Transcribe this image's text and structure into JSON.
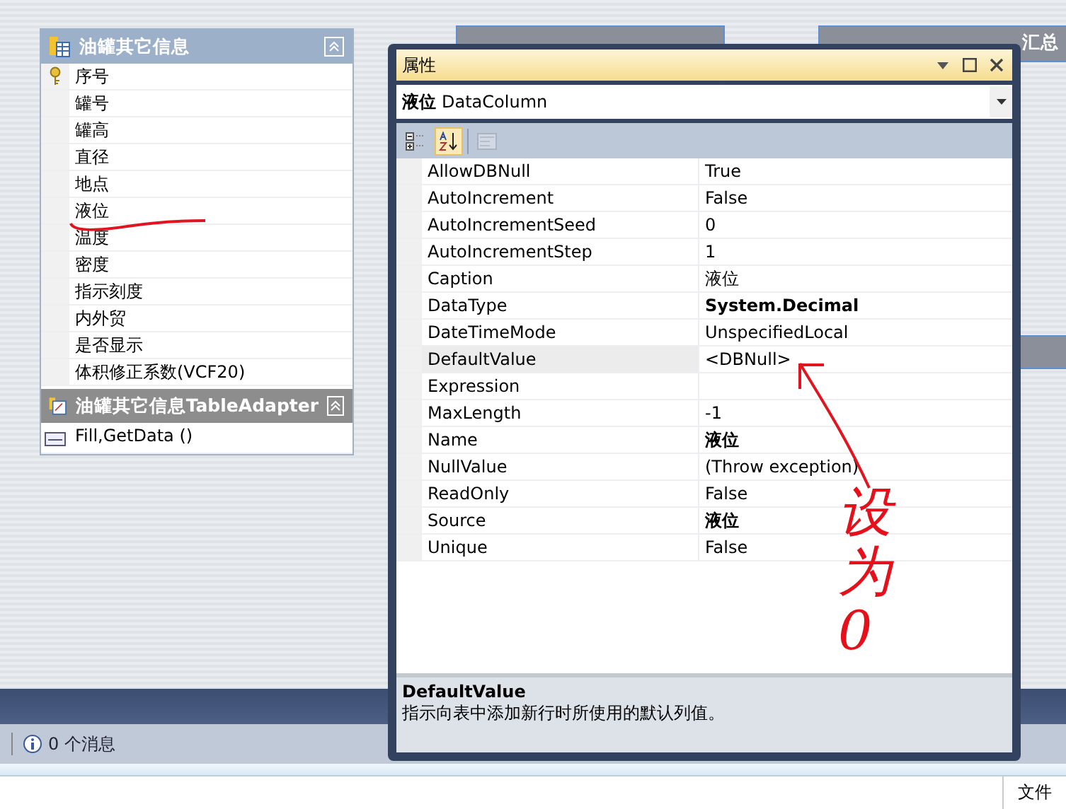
{
  "designer": {
    "tables": [
      {
        "title": "油罐其它信息",
        "columns": [
          {
            "name": "序号",
            "key": true
          },
          {
            "name": "罐号",
            "key": false
          },
          {
            "name": "罐高",
            "key": false
          },
          {
            "name": "直径",
            "key": false
          },
          {
            "name": "地点",
            "key": false
          },
          {
            "name": "液位",
            "key": false
          },
          {
            "name": "温度",
            "key": false
          },
          {
            "name": "密度",
            "key": false
          },
          {
            "name": "指示刻度",
            "key": false
          },
          {
            "name": "内外贸",
            "key": false
          },
          {
            "name": "是否显示",
            "key": false
          },
          {
            "name": "体积修正系数(VCF20)",
            "key": false
          }
        ],
        "adapter": {
          "title": "油罐其它信息TableAdapter",
          "methods": [
            "Fill,GetData ()"
          ]
        }
      }
    ],
    "obscured_table_title": "汇总"
  },
  "properties": {
    "title": "属性",
    "object": {
      "name": "液位",
      "type": "DataColumn"
    },
    "toolbar": [
      {
        "kind": "categorized",
        "selected": false,
        "disabled": false
      },
      {
        "kind": "alphabetical",
        "selected": true,
        "disabled": false
      },
      {
        "kind": "pages",
        "selected": false,
        "disabled": true
      }
    ],
    "rows": [
      {
        "name": "AllowDBNull",
        "value": "True",
        "bold": false,
        "selected": false
      },
      {
        "name": "AutoIncrement",
        "value": "False",
        "bold": false,
        "selected": false
      },
      {
        "name": "AutoIncrementSeed",
        "value": "0",
        "bold": false,
        "selected": false
      },
      {
        "name": "AutoIncrementStep",
        "value": "1",
        "bold": false,
        "selected": false
      },
      {
        "name": "Caption",
        "value": "液位",
        "bold": false,
        "selected": false
      },
      {
        "name": "DataType",
        "value": "System.Decimal",
        "bold": true,
        "selected": false
      },
      {
        "name": "DateTimeMode",
        "value": "UnspecifiedLocal",
        "bold": false,
        "selected": false
      },
      {
        "name": "DefaultValue",
        "value": "<DBNull>",
        "bold": false,
        "selected": true
      },
      {
        "name": "Expression",
        "selected": false
      },
      {
        "name": "MaxLength",
        "value": "-1",
        "bold": false,
        "selected": false
      },
      {
        "name": "Name",
        "value": "液位",
        "bold": true,
        "selected": false
      },
      {
        "name": "NullValue",
        "value": "(Throw exception)",
        "bold": false,
        "selected": false
      },
      {
        "name": "ReadOnly",
        "value": "False",
        "bold": false,
        "selected": false
      },
      {
        "name": "Source",
        "value": "液位",
        "bold": true,
        "selected": false
      },
      {
        "name": "Unique",
        "value": "False",
        "bold": false,
        "selected": false
      }
    ],
    "description": {
      "title": "DefaultValue",
      "text": "指示向表中添加新行时所使用的默认列值。"
    }
  },
  "annotation": {
    "note": "设为0"
  },
  "status_bar": {
    "messages": "0 个消息"
  },
  "bottom_tab": {
    "label": "文件"
  }
}
